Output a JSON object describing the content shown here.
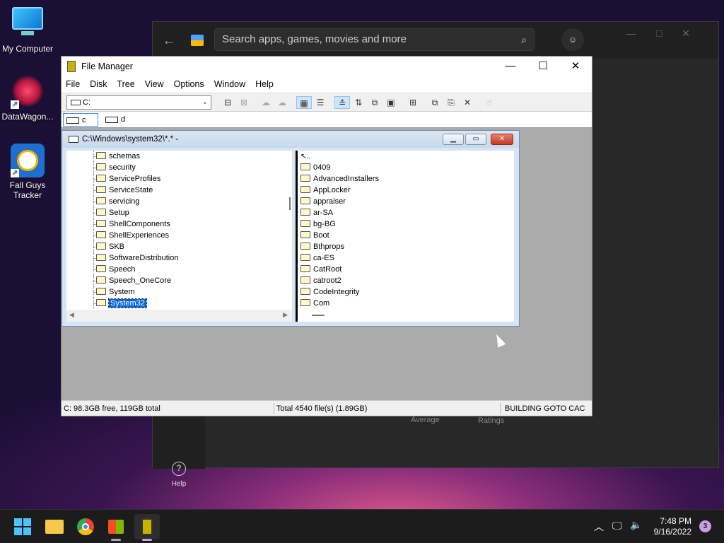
{
  "desktop": {
    "icons": [
      {
        "label": "My Computer",
        "icon": "monitor-icon"
      },
      {
        "label": "DataWagon...",
        "icon": "datawagon-icon"
      },
      {
        "label": "Fall Guys Tracker",
        "icon": "fall-guys-icon"
      }
    ]
  },
  "store": {
    "search_placeholder": "Search apps, games, movies and more",
    "help_label": "Help",
    "average_label": "Average",
    "ratings_label": "Ratings"
  },
  "file_manager": {
    "title": "File Manager",
    "menu": [
      "File",
      "Disk",
      "Tree",
      "View",
      "Options",
      "Window",
      "Help"
    ],
    "drive_select": "C:",
    "drives": [
      "c",
      "d"
    ],
    "child": {
      "title": "C:\\Windows\\system32\\*.* -",
      "tree": [
        "schemas",
        "security",
        "ServiceProfiles",
        "ServiceState",
        "servicing",
        "Setup",
        "ShellComponents",
        "ShellExperiences",
        "SKB",
        "SoftwareDistribution",
        "Speech",
        "Speech_OneCore",
        "System",
        "System32"
      ],
      "selected_tree_item": "System32",
      "parent_entry": "..",
      "files": [
        "0409",
        "AdvancedInstallers",
        "AppLocker",
        "appraiser",
        "ar-SA",
        "bg-BG",
        "Boot",
        "Bthprops",
        "ca-ES",
        "CatRoot",
        "catroot2",
        "CodeIntegrity",
        "Com"
      ]
    },
    "status": {
      "free": "C: 98.3GB free,  119GB total",
      "total": "Total 4540 file(s) (1.89GB)",
      "extra": "BUILDING GOTO CAC"
    }
  },
  "taskbar": {
    "time": "7:48 PM",
    "date": "9/16/2022",
    "notifications": "3"
  }
}
